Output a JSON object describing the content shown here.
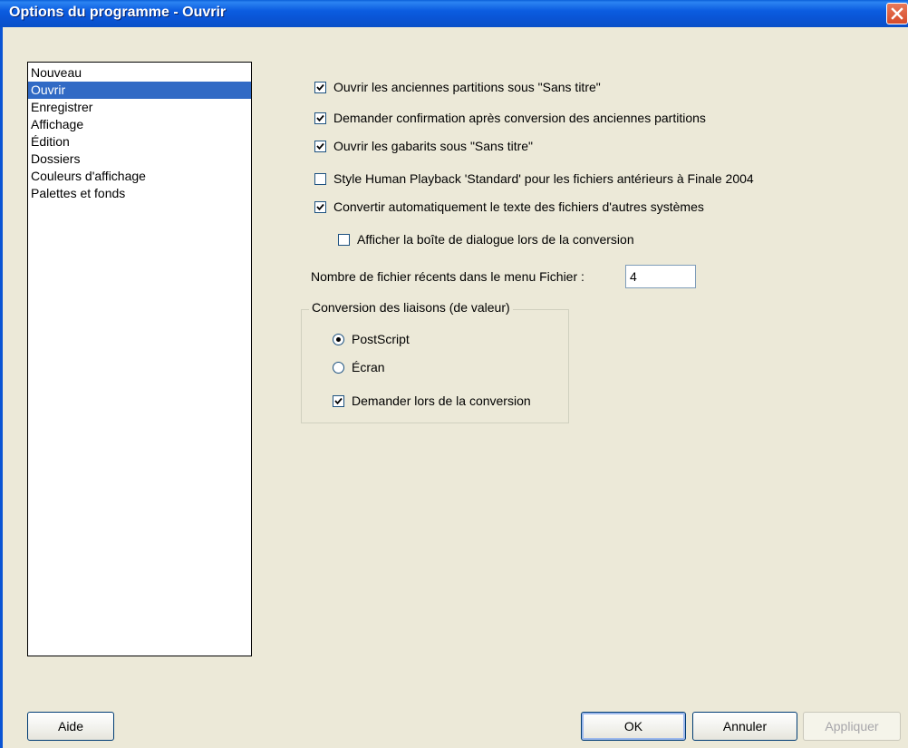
{
  "window": {
    "title": "Options du programme - Ouvrir"
  },
  "sidebar": {
    "items": [
      {
        "label": "Nouveau",
        "selected": false
      },
      {
        "label": "Ouvrir",
        "selected": true
      },
      {
        "label": "Enregistrer",
        "selected": false
      },
      {
        "label": "Affichage",
        "selected": false
      },
      {
        "label": "Édition",
        "selected": false
      },
      {
        "label": "Dossiers",
        "selected": false
      },
      {
        "label": "Couleurs d'affichage",
        "selected": false
      },
      {
        "label": "Palettes et fonds",
        "selected": false
      }
    ]
  },
  "options": [
    {
      "label": "Ouvrir les anciennes partitions sous \"Sans titre\"",
      "checked": true
    },
    {
      "label": "Demander confirmation après conversion des anciennes partitions",
      "checked": true
    },
    {
      "label": "Ouvrir les gabarits sous \"Sans titre\"",
      "checked": true
    },
    {
      "label": "Style Human Playback 'Standard' pour les fichiers antérieurs à Finale 2004",
      "checked": false
    },
    {
      "label": "Convertir automatiquement le texte des fichiers d'autres systèmes",
      "checked": true
    },
    {
      "label": "Afficher la boîte de dialogue lors de la conversion",
      "checked": false
    }
  ],
  "recent_files": {
    "label": "Nombre de fichier récents dans le menu Fichier :",
    "value": "4"
  },
  "conversion_group": {
    "legend": "Conversion des liaisons (de valeur)",
    "radios": [
      {
        "label": "PostScript",
        "selected": true
      },
      {
        "label": "Écran",
        "selected": false
      }
    ],
    "ask_checkbox": {
      "label": "Demander lors de la conversion",
      "checked": true
    }
  },
  "buttons": {
    "help": "Aide",
    "ok": "OK",
    "cancel": "Annuler",
    "apply": "Appliquer"
  },
  "colors": {
    "titlebar": "#0a54d4",
    "selection": "#316ac5",
    "dialog_bg": "#ece9d8"
  }
}
